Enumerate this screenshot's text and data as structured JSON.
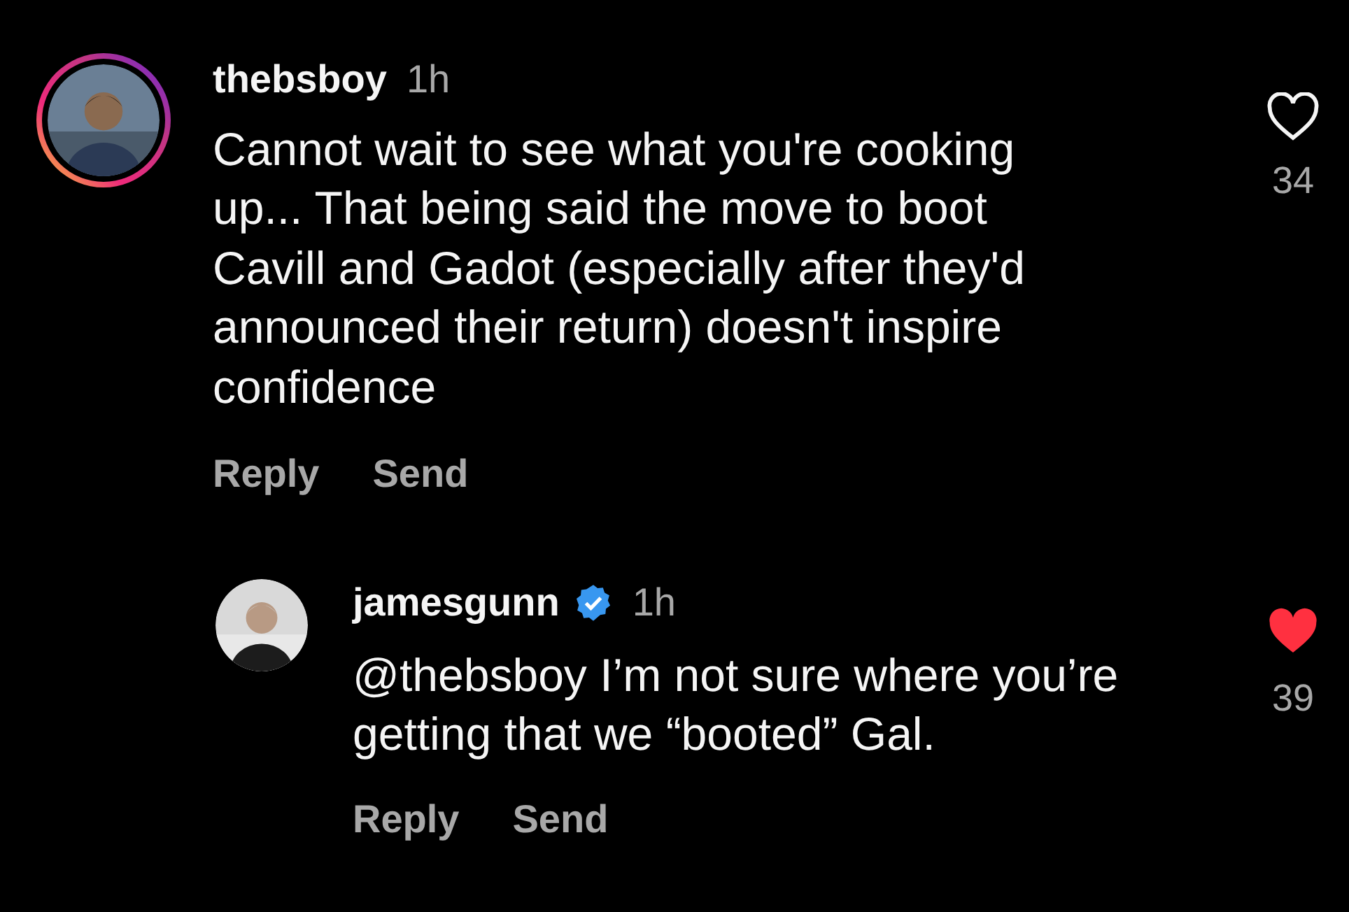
{
  "comments": [
    {
      "username": "thebsboy",
      "verified": false,
      "story_ring": true,
      "time": "1h",
      "text": "Cannot wait to see what you're cooking up... That being said the move to boot Cavill and Gadot (especially after they'd announced their return) doesn't inspire confidence",
      "liked": false,
      "likes": "34",
      "actions": [
        "Reply",
        "Send"
      ],
      "children": [
        {
          "username": "jamesgunn",
          "verified": true,
          "story_ring": false,
          "time": "1h",
          "text": "@thebsboy I’m not sure where you’re getting that we “booted” Gal.",
          "liked": true,
          "likes": "39",
          "actions": [
            "Reply",
            "Send"
          ]
        }
      ]
    }
  ]
}
